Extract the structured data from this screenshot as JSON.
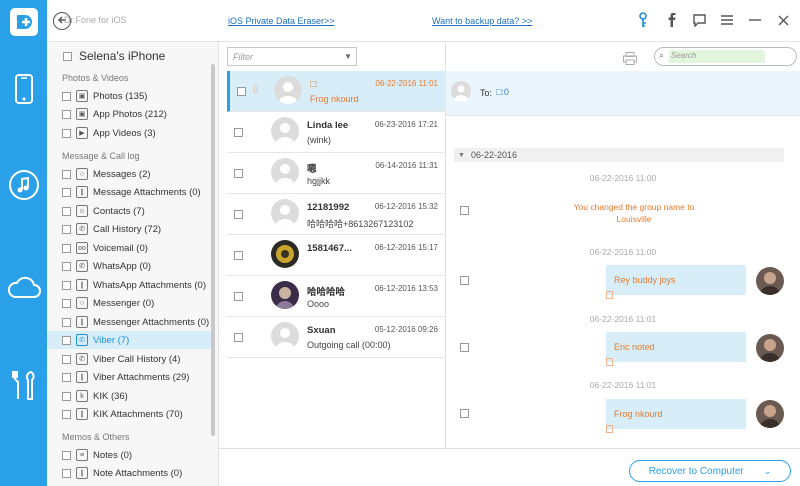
{
  "app": {
    "title": "Dr.Fone for iOS",
    "links": [
      "iOS Private Data Eraser>>",
      "Want to backup data? >>"
    ],
    "accent": "#2aa0e8"
  },
  "rail": {
    "items": [
      "phone-icon",
      "music-icon",
      "cloud-icon",
      "tools-icon"
    ]
  },
  "sidebar": {
    "device": "Selena's iPhone",
    "sections": [
      {
        "title": "Photos & Videos",
        "items": [
          "Photos (135)",
          "App Photos (212)",
          "App Videos (3)"
        ]
      },
      {
        "title": "Message & Call log",
        "items": [
          "Messages (2)",
          "Message Attachments (0)",
          "Contacts (7)",
          "Call History (72)",
          "Voicemail (0)",
          "WhatsApp (0)",
          "WhatsApp Attachments (0)",
          "Messenger (0)",
          "Messenger Attachments (0)",
          "Viber (7)",
          "Viber Call History (4)",
          "Viber Attachments (29)",
          "KIK (36)",
          "KIK Attachments (70)"
        ]
      },
      {
        "title": "Memos & Others",
        "items": [
          "Notes (0)",
          "Note Attachments (0)"
        ]
      }
    ],
    "active": "Viber (7)"
  },
  "list": {
    "filter_placeholder": "Filter",
    "conversations": [
      {
        "name": "□:",
        "date": "06-22-2016 11:01",
        "msg": "Frog nkourd"
      },
      {
        "name": "Linda lee",
        "date": "06-23-2016 17:21",
        "msg": "(wink)"
      },
      {
        "name": "嗯",
        "date": "06-14-2016 11:31",
        "msg": "hgjjkk"
      },
      {
        "name": "12181992",
        "date": "06-12-2016 15:32",
        "msg": "哈哈哈哈+8613267123102"
      },
      {
        "name": "1581467...",
        "date": "06-12-2016 15:17",
        "msg": ""
      },
      {
        "name": "哈哈哈哈",
        "date": "06-12-2016 13:53",
        "msg": "Oooo"
      },
      {
        "name": "Sxuan",
        "date": "05-12-2016 09:26",
        "msg": "Outgoing call (00:00)"
      }
    ]
  },
  "detail": {
    "search_placeholder": "Search",
    "to_label": "To:",
    "to_value": "□:0",
    "date_group": "06-22-2016",
    "stamps": [
      "06-22-2016 11:00",
      "06-22-2016 11:00",
      "06-22-2016 11:01",
      "06-22-2016 11:01"
    ],
    "system_message": "You changed the group name to Louisville",
    "messages": [
      "Rey buddy joys",
      "Eric noted",
      "Frog nkourd"
    ]
  },
  "bottom": {
    "recover_label": "Recover to Computer"
  }
}
